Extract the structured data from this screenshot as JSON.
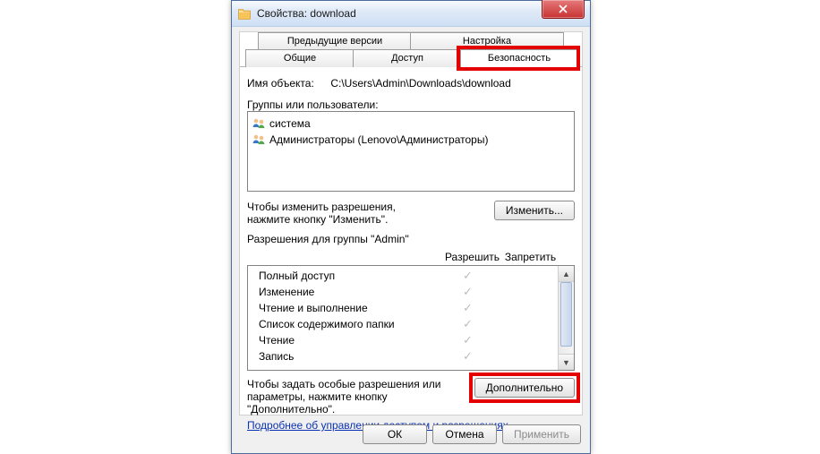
{
  "window": {
    "title": "Свойства: download"
  },
  "tabs": {
    "prev_versions": "Предыдущие версии",
    "customize": "Настройка",
    "general": "Общие",
    "sharing": "Доступ",
    "security": "Безопасность"
  },
  "object": {
    "label": "Имя объекта:",
    "path": "C:\\Users\\Admin\\Downloads\\download"
  },
  "groups": {
    "label": "Группы или пользователи:",
    "items": [
      {
        "name": "система"
      },
      {
        "name": "Администраторы (Lenovo\\Администраторы)"
      }
    ]
  },
  "edit": {
    "hint": "Чтобы изменить разрешения, нажмите кнопку \"Изменить\".",
    "button": "Изменить..."
  },
  "permissions": {
    "for_label": "Разрешения для группы \"Admin\"",
    "allow": "Разрешить",
    "deny": "Запретить",
    "rows": [
      {
        "name": "Полный доступ",
        "allow": true
      },
      {
        "name": "Изменение",
        "allow": true
      },
      {
        "name": "Чтение и выполнение",
        "allow": true
      },
      {
        "name": "Список содержимого папки",
        "allow": true
      },
      {
        "name": "Чтение",
        "allow": true
      },
      {
        "name": "Запись",
        "allow": true
      }
    ]
  },
  "advanced": {
    "hint": "Чтобы задать особые разрешения или параметры, нажмите кнопку \"Дополнительно\".",
    "button": "Дополнительно"
  },
  "link": "Подробнее об управлении доступом и разрешениях",
  "footer": {
    "ok": "ОК",
    "cancel": "Отмена",
    "apply": "Применить"
  }
}
